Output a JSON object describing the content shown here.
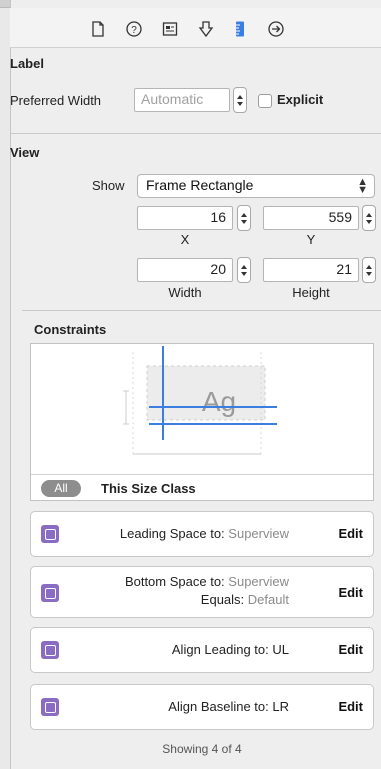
{
  "toolbar": {
    "tabs": [
      {
        "icon": "file-icon"
      },
      {
        "icon": "help-icon"
      },
      {
        "icon": "id-card-icon"
      },
      {
        "icon": "attributes-icon"
      },
      {
        "icon": "ruler-icon",
        "selected": true
      },
      {
        "icon": "arrow-circle-icon"
      }
    ],
    "accent_color": "#3b7de0"
  },
  "label_section": {
    "title": "Label",
    "preferred_width_label": "Preferred Width",
    "preferred_width_placeholder": "Automatic",
    "explicit_label": "Explicit",
    "explicit_checked": false
  },
  "view_section": {
    "title": "View",
    "show_label": "Show",
    "show_value": "Frame Rectangle",
    "x_value": "16",
    "y_value": "559",
    "x_label": "X",
    "y_label": "Y",
    "width_value": "20",
    "height_value": "21",
    "width_label": "Width",
    "height_label": "Height"
  },
  "constraints_section": {
    "title": "Constraints",
    "preview_text": "Ag",
    "all_pill": "All",
    "size_class_label": "This Size Class",
    "rows": [
      {
        "key": "Leading Space to:",
        "value": "Superview",
        "key2": "",
        "value2": "",
        "edit": "Edit"
      },
      {
        "key": "Bottom Space to:",
        "value": "Superview",
        "key2": "Equals:",
        "value2": "Default",
        "edit": "Edit"
      },
      {
        "key": "Align Leading to:",
        "value": "UL",
        "key2": "",
        "value2": "",
        "edit": "Edit"
      },
      {
        "key": "Align Baseline to:",
        "value": "LR",
        "key2": "",
        "value2": "",
        "edit": "Edit"
      }
    ],
    "footer": "Showing 4 of 4"
  }
}
